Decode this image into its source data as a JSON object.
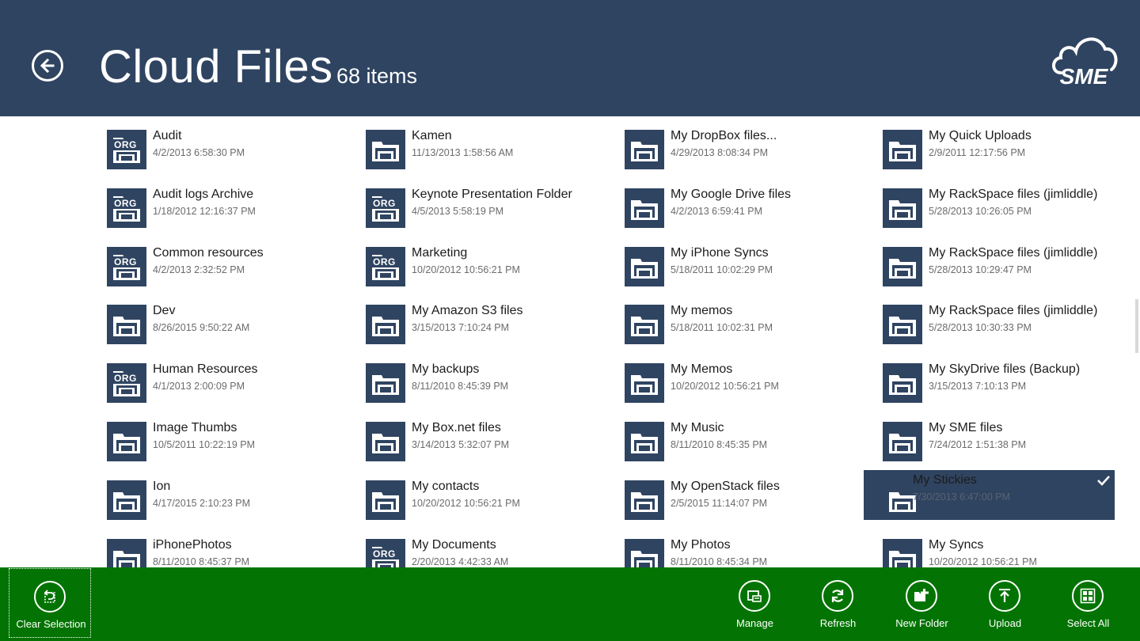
{
  "header": {
    "title": "Cloud Files",
    "count": "68 items",
    "logo_text": "SME"
  },
  "icons": {
    "back": "back-arrow-icon",
    "folder": "folder-icon",
    "org_folder": "org-folder-icon",
    "check": "checkmark-icon"
  },
  "colors": {
    "header_bg": "#2f4461",
    "appbar_bg": "#037403",
    "selected_bg": "#2f4461"
  },
  "columns": [
    [
      {
        "name": "Audit",
        "date": "4/2/2013 6:58:30 PM",
        "org": true
      },
      {
        "name": "Audit logs Archive",
        "date": "1/18/2012 12:16:37 PM",
        "org": true
      },
      {
        "name": "Common resources",
        "date": "4/2/2013 2:32:52 PM",
        "org": true
      },
      {
        "name": "Dev",
        "date": "8/26/2015 9:50:22 AM",
        "org": false
      },
      {
        "name": "Human Resources",
        "date": "4/1/2013 2:00:09 PM",
        "org": true
      },
      {
        "name": "Image Thumbs",
        "date": "10/5/2011 10:22:19 PM",
        "org": false
      },
      {
        "name": "Ion",
        "date": "4/17/2015 2:10:23 PM",
        "org": false
      },
      {
        "name": "iPhonePhotos",
        "date": "8/11/2010 8:45:37 PM",
        "org": false
      }
    ],
    [
      {
        "name": "Kamen",
        "date": "11/13/2013 1:58:56 AM",
        "org": false
      },
      {
        "name": "Keynote Presentation Folder",
        "date": "4/5/2013 5:58:19 PM",
        "org": true
      },
      {
        "name": "Marketing",
        "date": "10/20/2012 10:56:21 PM",
        "org": true
      },
      {
        "name": "My Amazon S3 files",
        "date": "3/15/2013 7:10:24 PM",
        "org": false
      },
      {
        "name": "My backups",
        "date": "8/11/2010 8:45:39 PM",
        "org": false
      },
      {
        "name": "My Box.net files",
        "date": "3/14/2013 5:32:07 PM",
        "org": false
      },
      {
        "name": "My contacts",
        "date": "10/20/2012 10:56:21 PM",
        "org": false
      },
      {
        "name": "My Documents",
        "date": "2/20/2013 4:42:33 AM",
        "org": true
      }
    ],
    [
      {
        "name": "My DropBox files...",
        "date": "4/29/2013 8:08:34 PM",
        "org": false
      },
      {
        "name": "My Google Drive files",
        "date": "4/2/2013 6:59:41 PM",
        "org": false
      },
      {
        "name": "My iPhone Syncs",
        "date": "5/18/2011 10:02:29 PM",
        "org": false
      },
      {
        "name": "My memos",
        "date": "5/18/2011 10:02:31 PM",
        "org": false
      },
      {
        "name": "My Memos",
        "date": "10/20/2012 10:56:21 PM",
        "org": false
      },
      {
        "name": "My Music",
        "date": "8/11/2010 8:45:35 PM",
        "org": false
      },
      {
        "name": "My OpenStack files",
        "date": "2/5/2015 11:14:07 PM",
        "org": false
      },
      {
        "name": "My Photos",
        "date": "8/11/2010 8:45:34 PM",
        "org": false
      }
    ],
    [
      {
        "name": "My Quick Uploads",
        "date": "2/9/2011 12:17:56 PM",
        "org": false
      },
      {
        "name": "My RackSpace files (jimliddle)",
        "date": "5/28/2013 10:26:05 PM",
        "org": false
      },
      {
        "name": "My RackSpace files (jimliddle)",
        "date": "5/28/2013 10:29:47 PM",
        "org": false
      },
      {
        "name": "My RackSpace files (jimliddle)",
        "date": "5/28/2013 10:30:33 PM",
        "org": false
      },
      {
        "name": "My SkyDrive files (Backup)",
        "date": "3/15/2013 7:10:13 PM",
        "org": false
      },
      {
        "name": "My SME files",
        "date": "7/24/2012 1:51:38 PM",
        "org": false
      },
      {
        "name": "My Stickies",
        "date": "7/30/2013 6:47:00 PM",
        "org": false,
        "selected": true
      },
      {
        "name": "My Syncs",
        "date": "10/20/2012 10:56:21 PM",
        "org": false
      }
    ]
  ],
  "org_label": "ORG",
  "appbar": {
    "clear_selection": {
      "label": "Clear Selection",
      "icon": "undo-icon"
    },
    "manage": {
      "label": "Manage",
      "icon": "manage-icon"
    },
    "refresh": {
      "label": "Refresh",
      "icon": "refresh-icon"
    },
    "new_folder": {
      "label": "New Folder",
      "icon": "new-folder-icon"
    },
    "upload": {
      "label": "Upload",
      "icon": "upload-icon"
    },
    "select_all": {
      "label": "Select All",
      "icon": "select-all-icon"
    }
  }
}
